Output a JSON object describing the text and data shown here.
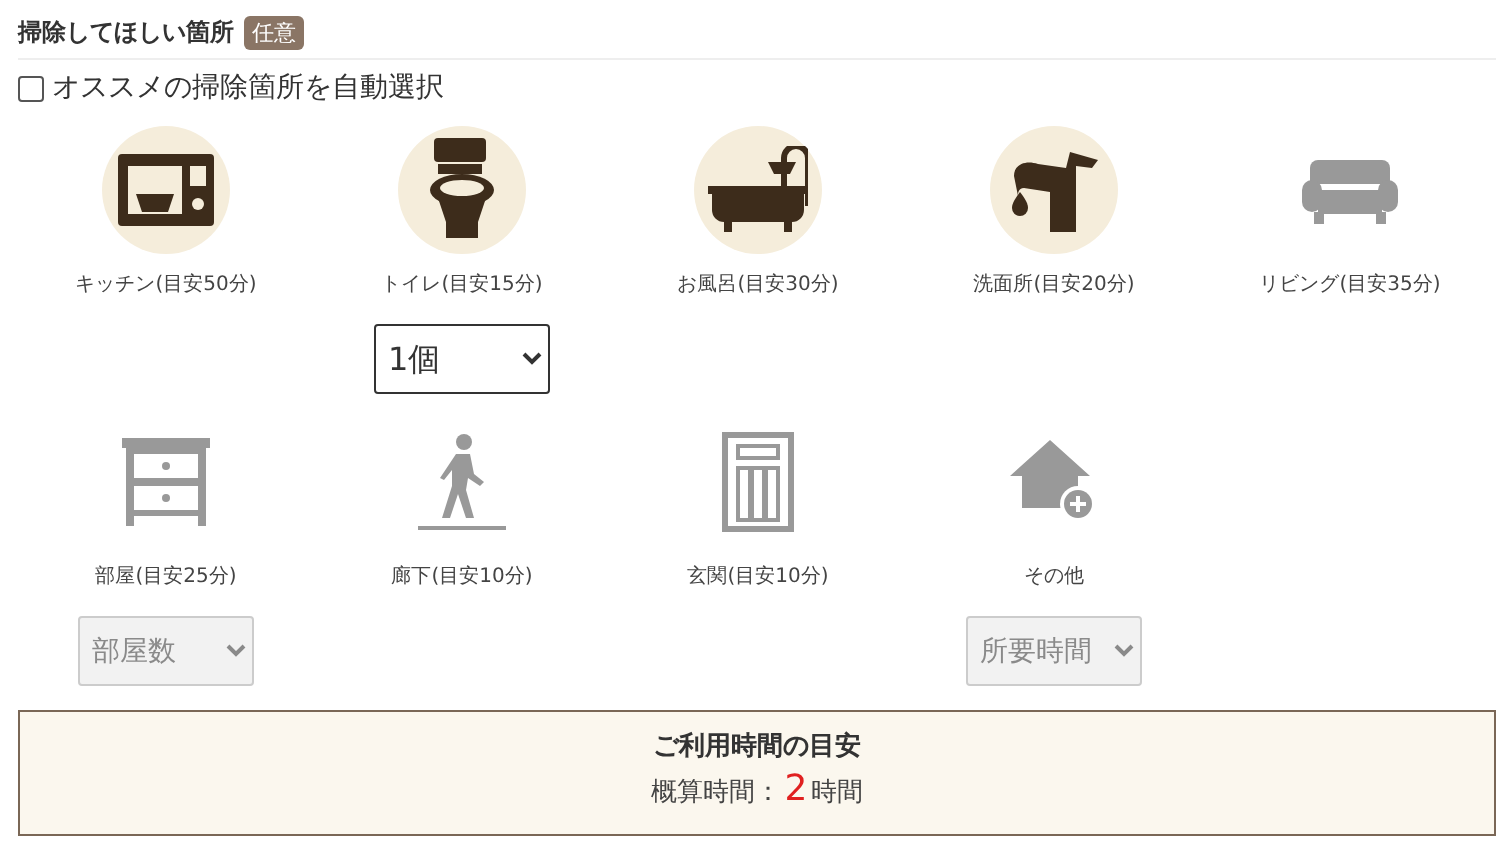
{
  "section": {
    "title": "掃除してほしい箇所",
    "badge": "任意"
  },
  "auto_select": {
    "label": "オススメの掃除箇所を自動選択",
    "checked": false
  },
  "areas": [
    {
      "label": "キッチン(目安50分)",
      "selected": true
    },
    {
      "label": "トイレ(目安15分)",
      "selected": true,
      "select": {
        "value": "1個",
        "disabled": false
      }
    },
    {
      "label": "お風呂(目安30分)",
      "selected": true
    },
    {
      "label": "洗面所(目安20分)",
      "selected": true
    },
    {
      "label": "リビング(目安35分)",
      "selected": false
    },
    {
      "label": "部屋(目安25分)",
      "selected": false,
      "select": {
        "value": "部屋数",
        "disabled": true
      }
    },
    {
      "label": "廊下(目安10分)",
      "selected": false
    },
    {
      "label": "玄関(目安10分)",
      "selected": false
    },
    {
      "label": "その他",
      "selected": false,
      "select": {
        "value": "所要時間",
        "disabled": true
      }
    }
  ],
  "estimate": {
    "title": "ご利用時間の目安",
    "prefix": "概算時間：",
    "value": "2",
    "unit": "時間"
  }
}
